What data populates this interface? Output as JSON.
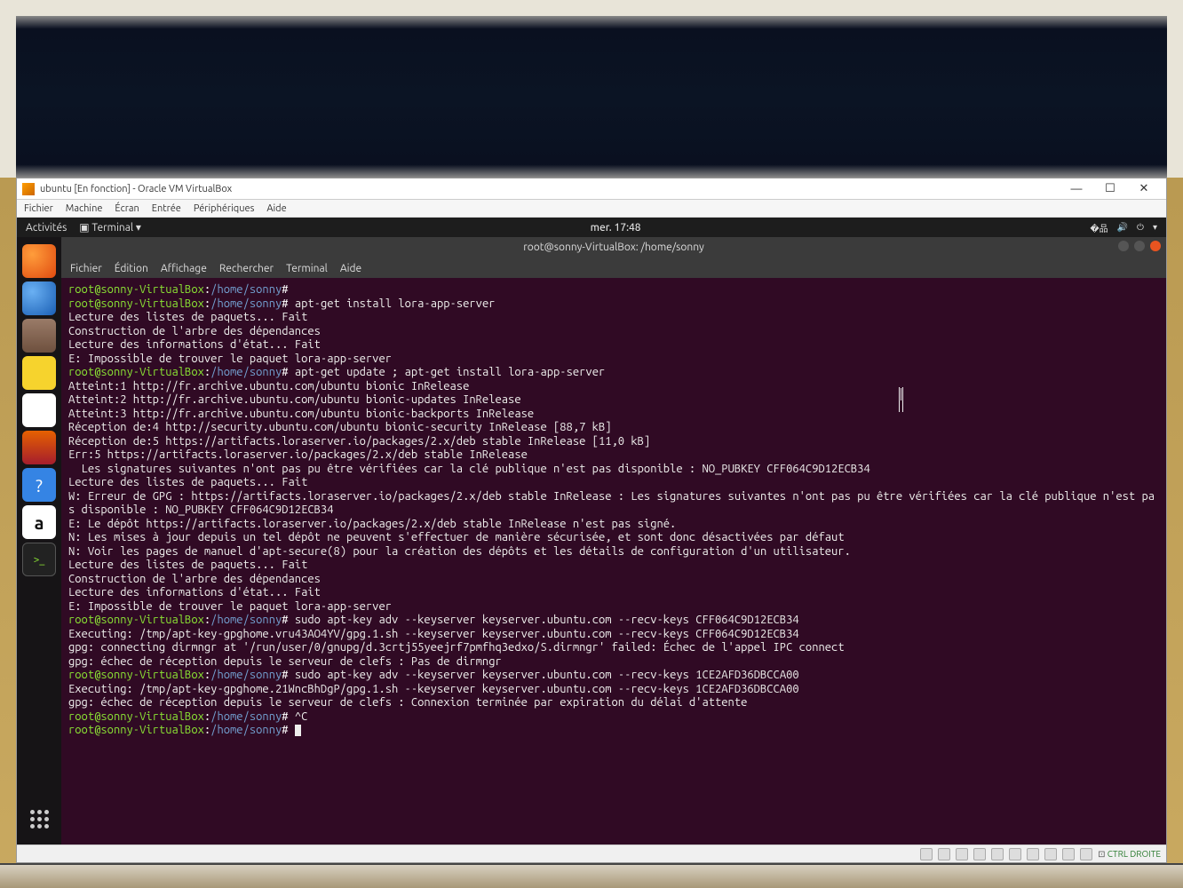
{
  "host_window": {
    "title": "ubuntu [En fonction] - Oracle VM VirtualBox",
    "menu": [
      "Fichier",
      "Machine",
      "Écran",
      "Entrée",
      "Périphériques",
      "Aide"
    ],
    "statusbar_key": "CTRL DROITE"
  },
  "gnome_panel": {
    "activities": "Activités",
    "app_menu": "Terminal ▾",
    "clock": "mer. 17:48"
  },
  "dock": [
    {
      "name": "firefox",
      "glyph": ""
    },
    {
      "name": "thunderbird",
      "glyph": ""
    },
    {
      "name": "files",
      "glyph": ""
    },
    {
      "name": "rhythmbox",
      "glyph": ""
    },
    {
      "name": "libreoffice-writer",
      "glyph": ""
    },
    {
      "name": "ubuntu-software",
      "glyph": ""
    },
    {
      "name": "help",
      "glyph": "?"
    },
    {
      "name": "amazon",
      "glyph": "a"
    },
    {
      "name": "terminal",
      "glyph": ">_"
    }
  ],
  "terminal": {
    "title": "root@sonny-VirtualBox: /home/sonny",
    "menu": [
      "Fichier",
      "Édition",
      "Affichage",
      "Rechercher",
      "Terminal",
      "Aide"
    ],
    "prompt_user": "root@sonny-VirtualBox",
    "prompt_path": "/home/sonny",
    "lines": [
      {
        "type": "prompt",
        "cmd": ""
      },
      {
        "type": "prompt",
        "cmd": "apt-get install lora-app-server"
      },
      {
        "type": "out",
        "text": "Lecture des listes de paquets... Fait"
      },
      {
        "type": "out",
        "text": "Construction de l'arbre des dépendances       "
      },
      {
        "type": "out",
        "text": "Lecture des informations d'état... Fait"
      },
      {
        "type": "out",
        "text": "E: Impossible de trouver le paquet lora-app-server"
      },
      {
        "type": "prompt",
        "cmd": "apt-get update ; apt-get install lora-app-server"
      },
      {
        "type": "out",
        "text": "Atteint:1 http://fr.archive.ubuntu.com/ubuntu bionic InRelease"
      },
      {
        "type": "out",
        "text": "Atteint:2 http://fr.archive.ubuntu.com/ubuntu bionic-updates InRelease"
      },
      {
        "type": "out",
        "text": "Atteint:3 http://fr.archive.ubuntu.com/ubuntu bionic-backports InRelease"
      },
      {
        "type": "out",
        "text": "Réception de:4 http://security.ubuntu.com/ubuntu bionic-security InRelease [88,7 kB]"
      },
      {
        "type": "out",
        "text": "Réception de:5 https://artifacts.loraserver.io/packages/2.x/deb stable InRelease [11,0 kB]"
      },
      {
        "type": "out",
        "text": "Err:5 https://artifacts.loraserver.io/packages/2.x/deb stable InRelease"
      },
      {
        "type": "out",
        "text": "  Les signatures suivantes n'ont pas pu être vérifiées car la clé publique n'est pas disponible : NO_PUBKEY CFF064C9D12ECB34"
      },
      {
        "type": "out",
        "text": "Lecture des listes de paquets... Fait"
      },
      {
        "type": "out",
        "text": "W: Erreur de GPG : https://artifacts.loraserver.io/packages/2.x/deb stable InRelease : Les signatures suivantes n'ont pas pu être vérifiées car la clé publique n'est pas disponible : NO_PUBKEY CFF064C9D12ECB34"
      },
      {
        "type": "out",
        "text": "E: Le dépôt https://artifacts.loraserver.io/packages/2.x/deb stable InRelease n'est pas signé."
      },
      {
        "type": "out",
        "text": "N: Les mises à jour depuis un tel dépôt ne peuvent s'effectuer de manière sécurisée, et sont donc désactivées par défaut"
      },
      {
        "type": "out",
        "text": "N: Voir les pages de manuel d'apt-secure(8) pour la création des dépôts et les détails de configuration d'un utilisateur."
      },
      {
        "type": "out",
        "text": "Lecture des listes de paquets... Fait"
      },
      {
        "type": "out",
        "text": "Construction de l'arbre des dépendances       "
      },
      {
        "type": "out",
        "text": "Lecture des informations d'état... Fait"
      },
      {
        "type": "out",
        "text": "E: Impossible de trouver le paquet lora-app-server"
      },
      {
        "type": "prompt",
        "cmd": "sudo apt-key adv --keyserver keyserver.ubuntu.com --recv-keys CFF064C9D12ECB34"
      },
      {
        "type": "out",
        "text": "Executing: /tmp/apt-key-gpghome.vru43AO4YV/gpg.1.sh --keyserver keyserver.ubuntu.com --recv-keys CFF064C9D12ECB34"
      },
      {
        "type": "out",
        "text": "gpg: connecting dirmngr at '/run/user/0/gnupg/d.3crtj55yeejrf7pmfhq3edxo/S.dirmngr' failed: Échec de l'appel IPC connect"
      },
      {
        "type": "out",
        "text": "gpg: échec de réception depuis le serveur de clefs : Pas de dirmngr"
      },
      {
        "type": "prompt",
        "cmd": "sudo apt-key adv --keyserver keyserver.ubuntu.com --recv-keys 1CE2AFD36DBCCA00"
      },
      {
        "type": "out",
        "text": "Executing: /tmp/apt-key-gpghome.21WncBhDgP/gpg.1.sh --keyserver keyserver.ubuntu.com --recv-keys 1CE2AFD36DBCCA00"
      },
      {
        "type": "out",
        "text": "gpg: échec de réception depuis le serveur de clefs : Connexion terminée par expiration du délai d'attente"
      },
      {
        "type": "prompt",
        "cmd": "^C"
      },
      {
        "type": "prompt",
        "cmd": "",
        "cursor": true
      }
    ]
  }
}
